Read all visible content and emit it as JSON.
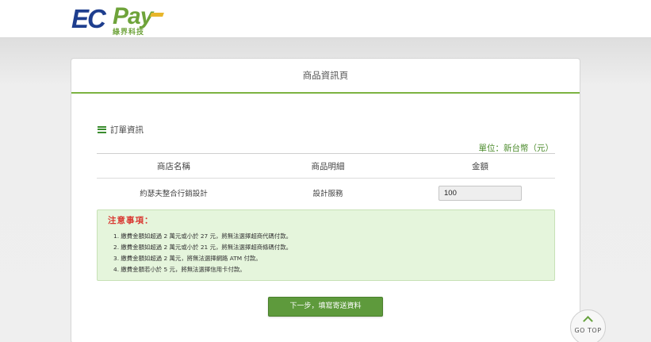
{
  "header": {
    "logo": {
      "brand_ec": "EC",
      "brand_pay": "Pay",
      "subtitle": "綠界科技"
    }
  },
  "page": {
    "title": "商品資訊頁"
  },
  "order": {
    "section_title": "訂單資訊",
    "unit_label": "單位：新台幣（元）",
    "columns": [
      "商店名稱",
      "商品明細",
      "金額"
    ],
    "row": {
      "store_name": "約瑟夫整合行銷設計",
      "item": "設計服務",
      "amount": "100"
    }
  },
  "notice": {
    "title": "注意事項：",
    "items": [
      "1.  繳費金額如超過 2 萬元或小於 27 元，將無法選擇超商代碼付款。",
      "2.  繳費金額如超過 2 萬元或小於 21 元，將無法選擇超商條碼付款。",
      "3.  繳費金額如超過 2 萬元，將無法選擇網路 ATM 付款。",
      "4.  繳費金額若小於 5 元，將無法選擇信用卡付款。"
    ]
  },
  "actions": {
    "next_label": "下一步，填寫寄送資料",
    "gotop_label": "GO TOP"
  },
  "colors": {
    "accent_green": "#7cb342",
    "button_green": "#5e9a3c",
    "notice_red": "#d93a33",
    "logo_blue": "#1e3e8e"
  }
}
